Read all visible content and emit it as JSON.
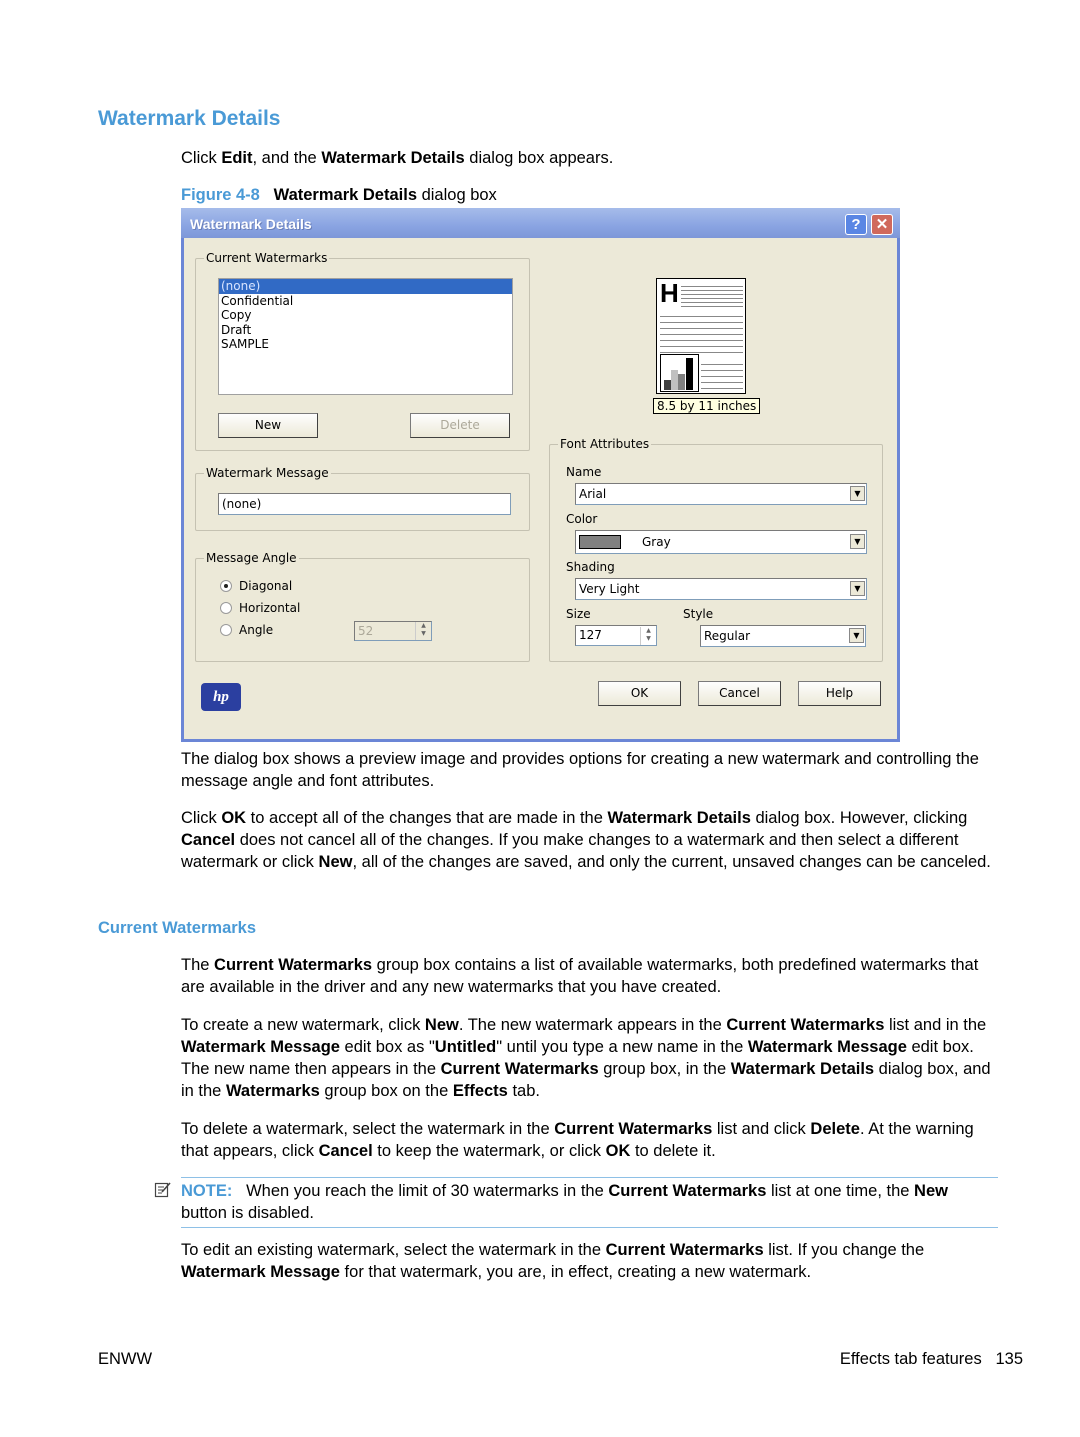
{
  "section_title": "Watermark Details",
  "intro": {
    "pre": "Click ",
    "b1": "Edit",
    "mid": ", and the ",
    "b2": "Watermark Details",
    "post": " dialog box appears."
  },
  "figure": {
    "number": "Figure 4-8",
    "b": "Watermark Details",
    "rest": " dialog box"
  },
  "dialog": {
    "title": "Watermark Details",
    "help_glyph": "?",
    "close_glyph": "✕",
    "current_watermarks": {
      "label": "Current Watermarks",
      "items": [
        "(none)",
        "Confidential",
        "Copy",
        "Draft",
        "SAMPLE"
      ],
      "selected_index": 0,
      "new_label": "New",
      "delete_label": "Delete"
    },
    "watermark_message": {
      "label": "Watermark Message",
      "value": "(none)"
    },
    "message_angle": {
      "label": "Message Angle",
      "options": [
        "Diagonal",
        "Horizontal",
        "Angle"
      ],
      "selected": "Diagonal",
      "angle_value": "52"
    },
    "preview": {
      "paper_size": "8.5 by 11 inches",
      "heading_glyph": "H"
    },
    "font_attributes": {
      "label": "Font Attributes",
      "name_label": "Name",
      "name_value": "Arial",
      "color_label": "Color",
      "color_value": "Gray",
      "color_swatch": "#808080",
      "shading_label": "Shading",
      "shading_value": "Very Light",
      "size_label": "Size",
      "size_value": "127",
      "style_label": "Style",
      "style_value": "Regular"
    },
    "ok_label": "OK",
    "cancel_label": "Cancel",
    "help_label": "Help",
    "logo_text": "hp"
  },
  "para1": "The dialog box shows a preview image and provides options for creating a new watermark and controlling the message angle and font attributes.",
  "para2": {
    "t1": "Click ",
    "b1": "OK",
    "t2": " to accept all of the changes that are made in the ",
    "b2": "Watermark Details",
    "t3": " dialog box. However, clicking ",
    "b3": "Cancel",
    "t4": " does not cancel all of the changes. If you make changes to a watermark and then select a different watermark or click ",
    "b4": "New",
    "t5": ", all of the changes are saved, and only the current, unsaved changes can be canceled."
  },
  "subsection_title": "Current Watermarks",
  "para3": {
    "t1": "The ",
    "b1": "Current Watermarks",
    "t2": " group box contains a list of available watermarks, both predefined watermarks that are available in the driver and any new watermarks that you have created."
  },
  "para4": {
    "t1": "To create a new watermark, click ",
    "b1": "New",
    "t2": ". The new watermark appears in the ",
    "b2": "Current Watermarks",
    "t3": " list and in the ",
    "b3": "Watermark Message",
    "t4": " edit box as \"",
    "b4": "Untitled",
    "t5": "\" until you type a new name in the ",
    "b5": "Watermark Message",
    "t6": " edit box. The new name then appears in the ",
    "b6": "Current Watermarks",
    "t7": " group box, in the ",
    "b7": "Watermark Details",
    "t8": " dialog box, and in the ",
    "b8": "Watermarks",
    "t9": " group box on the ",
    "b9": "Effects",
    "t10": " tab."
  },
  "para5": {
    "t1": "To delete a watermark, select the watermark in the ",
    "b1": "Current Watermarks",
    "t2": " list and click ",
    "b2": "Delete",
    "t3": ". At the warning that appears, click ",
    "b3": "Cancel",
    "t4": " to keep the watermark, or click ",
    "b4": "OK",
    "t5": " to delete it."
  },
  "note": {
    "label": "NOTE:",
    "t1": "   When you reach the limit of 30 watermarks in the ",
    "b1": "Current Watermarks",
    "t2": " list at one time, the ",
    "b2": "New",
    "t3": " button is disabled."
  },
  "para6": {
    "t1": "To edit an existing watermark, select the watermark in the ",
    "b1": "Current Watermarks",
    "t2": " list. If you change the ",
    "b2": "Watermark Message",
    "t3": " for that watermark, you are, in effect, creating a new watermark."
  },
  "footer": {
    "left": "ENWW",
    "right_text": "Effects tab features",
    "page": "135"
  }
}
